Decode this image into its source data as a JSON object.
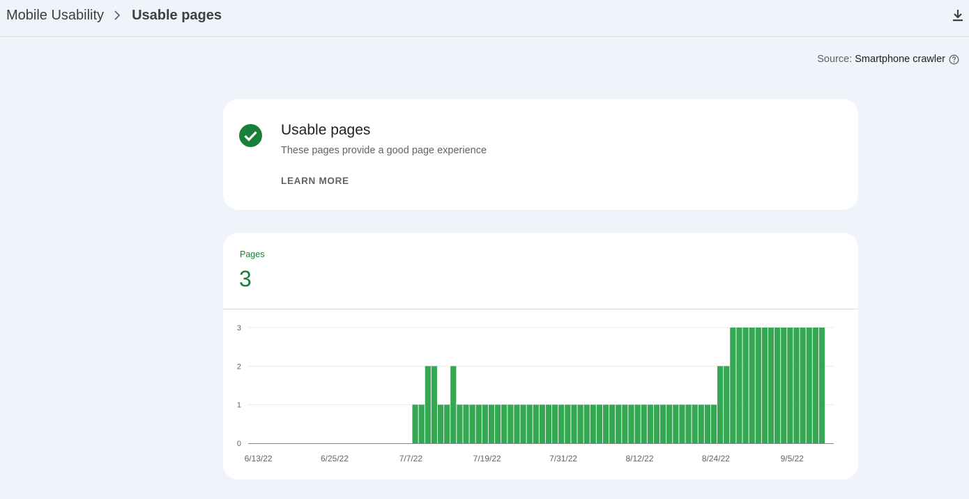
{
  "breadcrumb": {
    "parent": "Mobile Usability",
    "current": "Usable pages"
  },
  "source": {
    "label": "Source:",
    "value": "Smartphone crawler"
  },
  "status": {
    "title": "Usable pages",
    "description": "These pages provide a good page experience",
    "learn_more": "LEARN MORE",
    "color": "#188038"
  },
  "metric": {
    "label": "Pages",
    "value": "3"
  },
  "colors": {
    "bar": "#34a853",
    "accent": "#188038"
  },
  "chart_data": {
    "type": "bar",
    "ylim": [
      0,
      3
    ],
    "y_ticks": [
      "0",
      "1",
      "2",
      "3"
    ],
    "x_tick_labels": [
      "6/13/22",
      "6/25/22",
      "7/7/22",
      "7/19/22",
      "7/31/22",
      "8/12/22",
      "8/24/22",
      "9/5/22"
    ],
    "start_date": "6/13/22",
    "values": [
      0,
      0,
      0,
      0,
      0,
      0,
      0,
      0,
      0,
      0,
      0,
      0,
      0,
      0,
      0,
      0,
      0,
      0,
      0,
      0,
      0,
      0,
      0,
      0,
      0,
      0,
      1,
      1,
      2,
      2,
      1,
      1,
      2,
      1,
      1,
      1,
      1,
      1,
      1,
      1,
      1,
      1,
      1,
      1,
      1,
      1,
      1,
      1,
      1,
      1,
      1,
      1,
      1,
      1,
      1,
      1,
      1,
      1,
      1,
      1,
      1,
      1,
      1,
      1,
      1,
      1,
      1,
      1,
      1,
      1,
      1,
      1,
      1,
      1,
      2,
      2,
      3,
      3,
      3,
      3,
      3,
      3,
      3,
      3,
      3,
      3,
      3,
      3,
      3,
      3,
      3
    ],
    "grid": true
  }
}
